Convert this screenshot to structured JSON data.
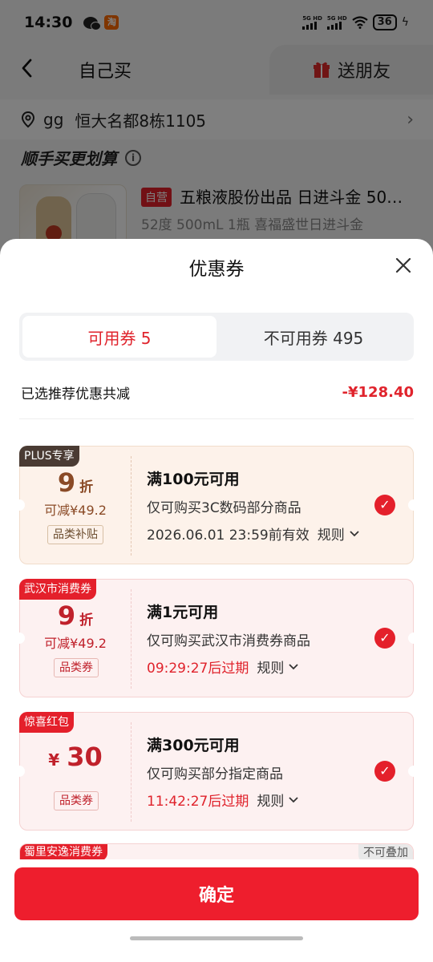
{
  "status_bar": {
    "time": "14:30",
    "taobao_glyph": "淘",
    "signal1_label": "5G HD",
    "signal2_label": "5G HD",
    "battery": "36"
  },
  "nav": {
    "tab_self": "自己买",
    "tab_gift": "送朋友"
  },
  "address": {
    "name": "gg",
    "detail": "恒大名都8栋1105"
  },
  "promo": {
    "title": "顺手买更划算"
  },
  "product": {
    "tag": "自营",
    "title": "五粮液股份出品 日进斗金 50…",
    "spec": "52度 500mL 1瓶 喜福盛世日进斗金"
  },
  "sheet": {
    "title": "优惠券",
    "tabs": {
      "available": "可用券 5",
      "unavailable": "不可用券 495"
    },
    "saving_label": "已选推荐优惠共减",
    "saving_value": "-¥128.40"
  },
  "coupons": [
    {
      "badge": "PLUS专享",
      "main_value": "9",
      "main_unit": "折",
      "sub": "可减¥49.2",
      "category": "品类补贴",
      "condition": "满100元可用",
      "scope": "仅可购买3C数码部分商品",
      "expire": "2026.06.01 23:59前有效",
      "rule": "规则",
      "selected": true
    },
    {
      "badge": "武汉市消费券",
      "main_value": "9",
      "main_unit": "折",
      "sub": "可减¥49.2",
      "category": "品类券",
      "condition": "满1元可用",
      "scope": "仅可购买武汉市消费券商品",
      "expire": "09:29:27后过期",
      "rule": "规则",
      "selected": true
    },
    {
      "badge": "惊喜红包",
      "currency": "¥",
      "main_value": "30",
      "category": "品类券",
      "condition": "满300元可用",
      "scope": "仅可购买部分指定商品",
      "expire": "11:42:27后过期",
      "rule": "规则",
      "selected": true
    }
  ],
  "coupon_peek": {
    "badge": "蜀里安逸消费券",
    "no_stack": "不可叠加"
  },
  "footer": {
    "confirm": "确定"
  },
  "colors": {
    "accent_red": "#e4202b",
    "confirm_red": "#ee1e2d",
    "plus_badge": "#4a3b33"
  },
  "icons": [
    "back-arrow-icon",
    "gift-icon",
    "location-pin-icon",
    "chevron-right-icon",
    "info-icon",
    "close-icon",
    "check-icon",
    "chevron-down-icon"
  ]
}
